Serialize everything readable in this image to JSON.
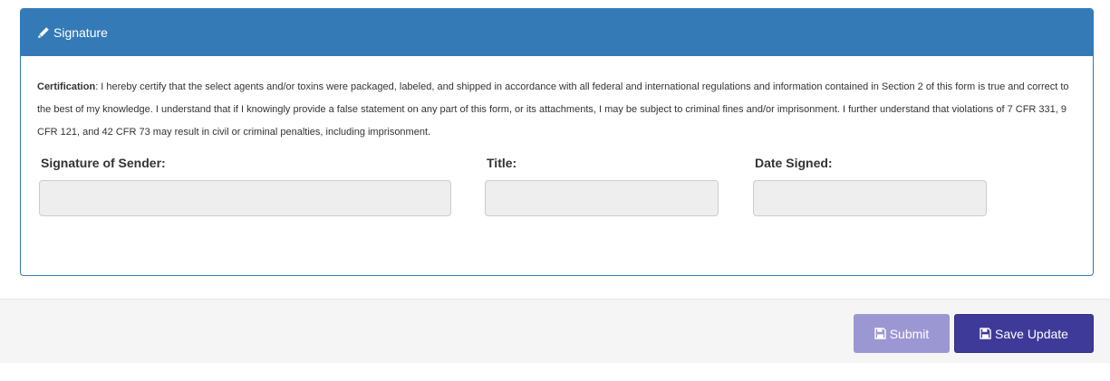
{
  "panel": {
    "title": "Signature",
    "title_icon": "pencil-icon",
    "header_color": "#337ab7"
  },
  "certification": {
    "label": "Certification",
    "text": ": I hereby certify that the select agents and/or toxins were packaged, labeled, and shipped in accordance with all federal and international regulations and information contained in Section 2 of this form is true and correct to the best of my knowledge. I understand that if I knowingly provide a false statement on any part of this form, or its attachments, I may be subject to criminal fines and/or imprisonment. I further understand that violations of 7 CFR 331, 9 CFR 121, and 42 CFR 73 may result in civil or criminal penalties, including imprisonment."
  },
  "fields": {
    "sender": {
      "label": "Signature of Sender:",
      "value": ""
    },
    "title": {
      "label": "Title:",
      "value": ""
    },
    "date": {
      "label": "Date Signed:",
      "value": ""
    }
  },
  "footer": {
    "submit_label": "Submit",
    "submit_icon": "floppy-disk-icon",
    "save_label": "Save Update",
    "save_icon": "floppy-disk-icon",
    "submit_color": "#9b97d2",
    "save_color": "#3e3a9a"
  }
}
